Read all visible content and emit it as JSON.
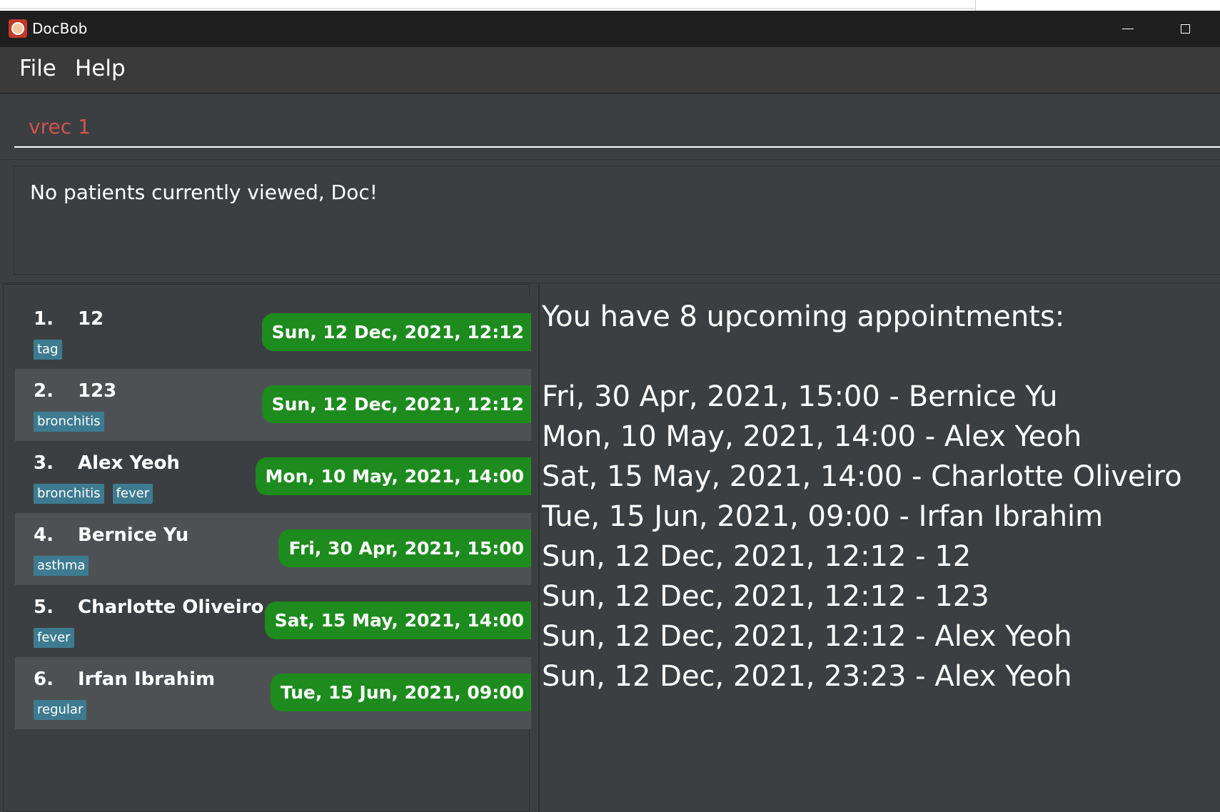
{
  "window": {
    "title": "DocBob"
  },
  "menu": {
    "file": "File",
    "help": "Help"
  },
  "command": {
    "value": "vrec 1"
  },
  "result": {
    "text": "No patients currently viewed, Doc!"
  },
  "patients": [
    {
      "index": "1.",
      "name": "12",
      "tags": [
        "tag"
      ],
      "appointment": "Sun, 12 Dec, 2021, 12:12"
    },
    {
      "index": "2.",
      "name": "123",
      "tags": [
        "bronchitis"
      ],
      "appointment": "Sun, 12 Dec, 2021, 12:12"
    },
    {
      "index": "3.",
      "name": "Alex Yeoh",
      "tags": [
        "bronchitis",
        "fever"
      ],
      "appointment": "Mon, 10 May, 2021, 14:00"
    },
    {
      "index": "4.",
      "name": "Bernice Yu",
      "tags": [
        "asthma"
      ],
      "appointment": "Fri, 30 Apr, 2021, 15:00"
    },
    {
      "index": "5.",
      "name": "Charlotte Oliveiro",
      "tags": [
        "fever"
      ],
      "appointment": "Sat, 15 May, 2021, 14:00"
    },
    {
      "index": "6.",
      "name": "Irfan Ibrahim",
      "tags": [
        "regular"
      ],
      "appointment": "Tue, 15 Jun, 2021, 09:00"
    }
  ],
  "appointments": {
    "header": "You have 8 upcoming appointments:",
    "items": [
      "Fri, 30 Apr, 2021, 15:00 - Bernice Yu",
      "Mon, 10 May, 2021, 14:00 - Alex Yeoh",
      "Sat, 15 May, 2021, 14:00 - Charlotte Oliveiro",
      "Tue, 15 Jun, 2021, 09:00 - Irfan Ibrahim",
      "Sun, 12 Dec, 2021, 12:12 - 12",
      "Sun, 12 Dec, 2021, 12:12 - 123",
      "Sun, 12 Dec, 2021, 12:12 - Alex Yeoh",
      "Sun, 12 Dec, 2021, 23:23 - Alex Yeoh"
    ]
  },
  "colors": {
    "background": "#3c3f41",
    "titlebar": "#1f1f1f",
    "command_text": "#d0534e",
    "appointment_badge": "#1d8b1d",
    "tag": "#3e7b91",
    "card_alt": "#4d5154"
  }
}
